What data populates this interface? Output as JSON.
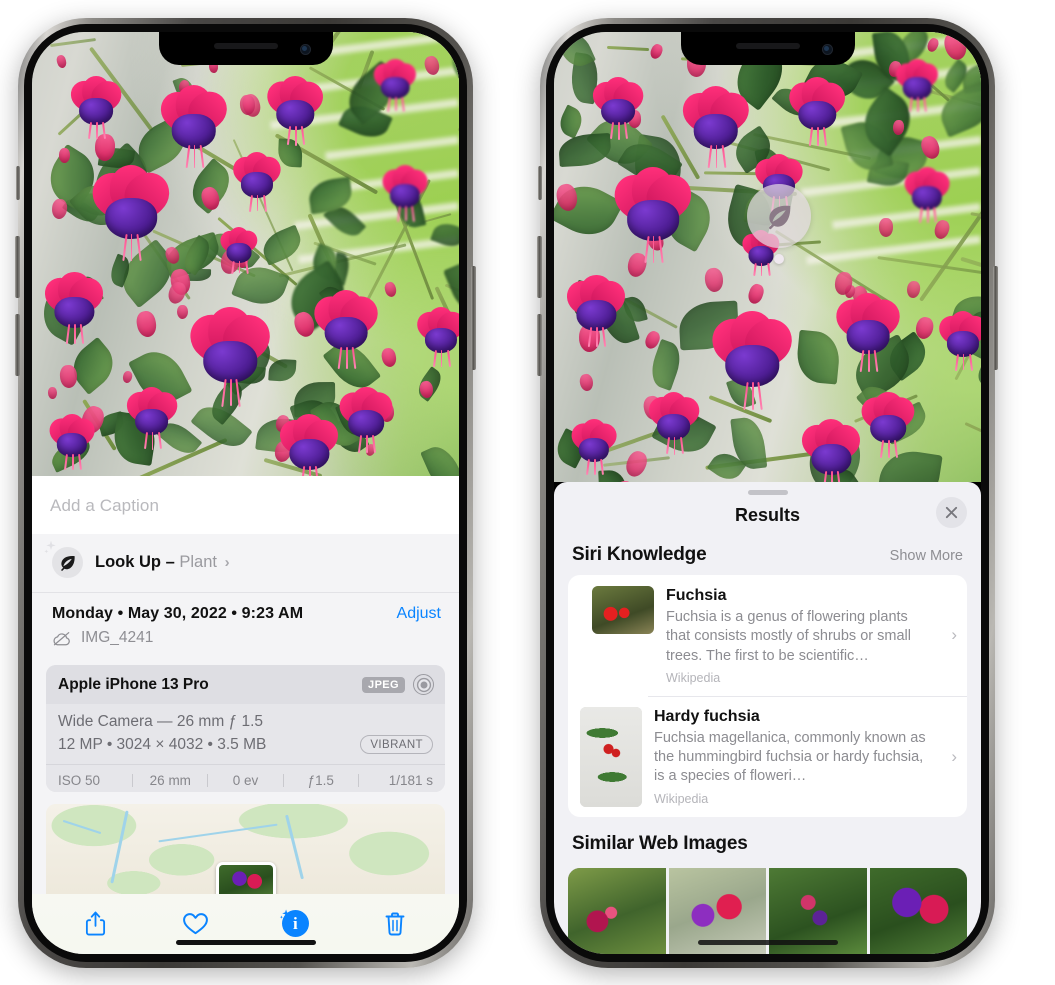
{
  "left_phone": {
    "caption": {
      "placeholder": "Add a Caption",
      "value": ""
    },
    "lookup": {
      "label": "Look Up",
      "dash": "–",
      "value": "Plant",
      "chevron": "›",
      "icon": "leaf-icon",
      "sparkle_icon": "sparkle-icon"
    },
    "meta": {
      "date": "Monday • May 30, 2022 • 9:23 AM",
      "adjust": "Adjust",
      "filename": "IMG_4241",
      "cloud_icon": "cloud-slash-icon"
    },
    "camera_card": {
      "device": "Apple iPhone 13 Pro",
      "format_badge": "JPEG",
      "lens_icon": "aperture-icon",
      "line1": "Wide Camera — 26 mm ƒ 1.5",
      "line2": "12 MP • 3024 × 4032 • 3.5 MB",
      "style_badge": "VIBRANT",
      "exif": [
        "ISO 50",
        "26 mm",
        "0 ev",
        "ƒ1.5",
        "1/181 s"
      ]
    },
    "toolbar": [
      {
        "name": "share-button",
        "icon": "share-icon",
        "active": false
      },
      {
        "name": "favorite-button",
        "icon": "heart-icon",
        "active": false
      },
      {
        "name": "info-button",
        "icon": "info-sparkle-icon",
        "active": true
      },
      {
        "name": "delete-button",
        "icon": "trash-icon",
        "active": false
      }
    ]
  },
  "right_phone": {
    "visual_lookup_badge": {
      "icon": "leaf-icon"
    },
    "sheet": {
      "title": "Results",
      "close_icon": "close-icon",
      "sections": [
        {
          "title": "Siri Knowledge",
          "action": "Show More"
        },
        {
          "title": "Similar Web Images",
          "action": ""
        }
      ],
      "knowledge": [
        {
          "title": "Fuchsia",
          "description": "Fuchsia is a genus of flowering plants that consists mostly of shrubs or small trees. The first to be scientific…",
          "source": "Wikipedia",
          "thumb": "fuchsia-red-flowers-thumbnail",
          "chevron": "›"
        },
        {
          "title": "Hardy fuchsia",
          "description": "Fuchsia magellanica, commonly known as the hummingbird fuchsia or hardy fuchsia, is a species of floweri…",
          "source": "Wikipedia",
          "thumb": "hardy-fuchsia-specimen-thumbnail",
          "chevron": "›"
        }
      ],
      "similar_images": [
        "fuchsia-pink-white-bloom",
        "fuchsia-red-purple-closeup",
        "fuchsia-shrub-buds",
        "fuchsia-purple-magenta-cluster"
      ]
    }
  },
  "colors": {
    "accent_blue": "#0a84ff",
    "panel_gray": "#f4f4f6",
    "sheet_gray": "#f1f1f5",
    "card_gray": "#e6e6ea",
    "muted_text": "#8e8e93"
  }
}
